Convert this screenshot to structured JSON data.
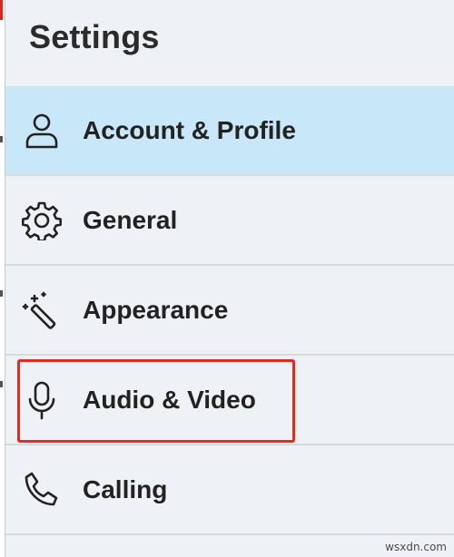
{
  "header": {
    "title": "Settings"
  },
  "menu": {
    "items": [
      {
        "label": "Account & Profile",
        "icon": "person-icon",
        "active": true
      },
      {
        "label": "General",
        "icon": "gear-icon",
        "active": false
      },
      {
        "label": "Appearance",
        "icon": "magic-wand-icon",
        "active": false
      },
      {
        "label": "Audio & Video",
        "icon": "microphone-icon",
        "active": false,
        "highlighted": true
      },
      {
        "label": "Calling",
        "icon": "phone-icon",
        "active": false
      }
    ]
  },
  "colors": {
    "active_background": "#c8e7f8",
    "highlight_border": "#e8291c",
    "panel_background": "#eef1f6"
  },
  "watermark": {
    "text": "wsxdn.com"
  }
}
